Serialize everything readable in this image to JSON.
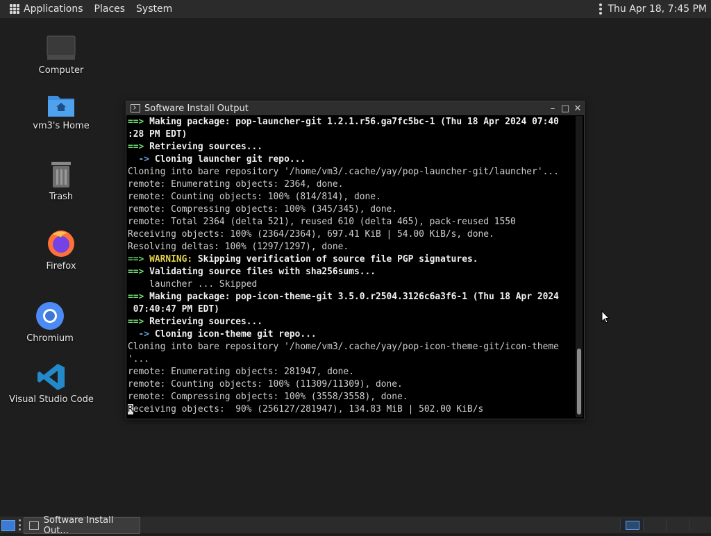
{
  "top_panel": {
    "menus": [
      "Applications",
      "Places",
      "System"
    ],
    "clock": "Thu Apr 18,  7:45 PM"
  },
  "desktop_icons": [
    {
      "label": "Computer",
      "icon": "computer-icon"
    },
    {
      "label": "vm3's Home",
      "icon": "home-folder-icon"
    },
    {
      "label": "Trash",
      "icon": "trash-icon"
    },
    {
      "label": "Firefox",
      "icon": "firefox-icon"
    },
    {
      "label": "Chromium",
      "icon": "chromium-icon"
    },
    {
      "label": "Visual Studio Code",
      "icon": "vscode-icon"
    }
  ],
  "window": {
    "title": "Software Install Output",
    "buttons": {
      "minimize": "–",
      "maximize": "□",
      "close": "✕"
    }
  },
  "terminal": {
    "lines": [
      {
        "type": "step",
        "text": "Making package: pop-launcher-git 1.2.1.r56.ga7fc5bc-1 (Thu 18 Apr 2024 07:40"
      },
      {
        "type": "step-cont",
        "text": ":28 PM EDT)"
      },
      {
        "type": "step",
        "text": "Retrieving sources..."
      },
      {
        "type": "substep",
        "text": "Cloning launcher git repo..."
      },
      {
        "type": "plain",
        "text": "Cloning into bare repository '/home/vm3/.cache/yay/pop-launcher-git/launcher'..."
      },
      {
        "type": "plain",
        "text": "remote: Enumerating objects: 2364, done."
      },
      {
        "type": "plain",
        "text": "remote: Counting objects: 100% (814/814), done."
      },
      {
        "type": "plain",
        "text": "remote: Compressing objects: 100% (345/345), done."
      },
      {
        "type": "plain",
        "text": "remote: Total 2364 (delta 521), reused 610 (delta 465), pack-reused 1550"
      },
      {
        "type": "plain",
        "text": "Receiving objects: 100% (2364/2364), 697.41 KiB | 54.00 KiB/s, done."
      },
      {
        "type": "plain",
        "text": "Resolving deltas: 100% (1297/1297), done."
      },
      {
        "type": "warning",
        "label": "WARNING:",
        "text": " Skipping verification of source file PGP signatures."
      },
      {
        "type": "step",
        "text": "Validating source files with sha256sums..."
      },
      {
        "type": "plain",
        "text": "    launcher ... Skipped"
      },
      {
        "type": "step",
        "text": "Making package: pop-icon-theme-git 3.5.0.r2504.3126c6a3f6-1 (Thu 18 Apr 2024"
      },
      {
        "type": "step-cont",
        "text": " 07:40:47 PM EDT)"
      },
      {
        "type": "step",
        "text": "Retrieving sources..."
      },
      {
        "type": "substep",
        "text": "Cloning icon-theme git repo..."
      },
      {
        "type": "plain",
        "text": "Cloning into bare repository '/home/vm3/.cache/yay/pop-icon-theme-git/icon-theme"
      },
      {
        "type": "plain",
        "text": "'..."
      },
      {
        "type": "plain",
        "text": "remote: Enumerating objects: 281947, done."
      },
      {
        "type": "plain",
        "text": "remote: Counting objects: 100% (11309/11309), done."
      },
      {
        "type": "plain",
        "text": "remote: Compressing objects: 100% (3558/3558), done."
      },
      {
        "type": "cursor",
        "text": "Receiving objects:  90% (256127/281947), 134.83 MiB | 502.00 KiB/s"
      }
    ],
    "arrow": "==>",
    "subarrow": "  ->"
  },
  "taskbar": {
    "task_label": "Software Install Out..."
  }
}
